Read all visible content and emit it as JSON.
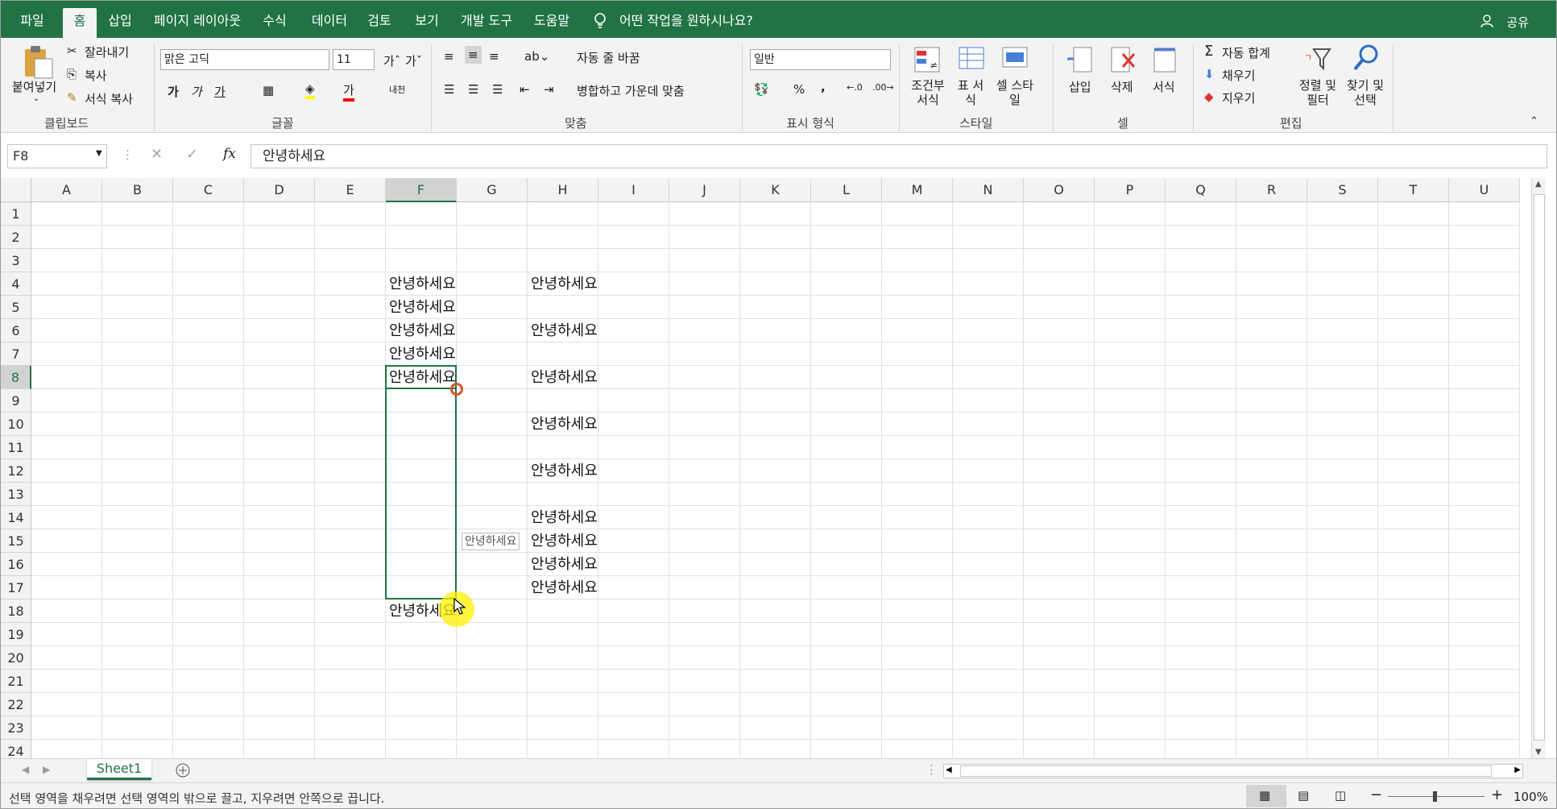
{
  "tabs": [
    "파일",
    "홈",
    "삽입",
    "페이지 레이아웃",
    "수식",
    "데이터",
    "검토",
    "보기",
    "개발 도구",
    "도움말"
  ],
  "tell_me": "어떤 작업을 원하시나요?",
  "share": "공유",
  "clipboard": {
    "paste": "붙여넣기",
    "cut": "잘라내기",
    "copy": "복사",
    "format_painter": "서식 복사",
    "group": "클립보드"
  },
  "font": {
    "name": "맑은 고딕",
    "size": "11",
    "bold": "가",
    "italic": "가",
    "underline": "가",
    "group": "글꼴",
    "color_glyph": "가",
    "phonetic": "내천"
  },
  "alignment": {
    "wrap": "자동 줄 바꿈",
    "merge": "병합하고 가운데 맞춤",
    "group": "맞춤"
  },
  "number": {
    "format": "일반",
    "percent": "%",
    "comma": ",",
    "group": "표시 형식"
  },
  "styles": {
    "conditional": "조건부 서식",
    "table": "표 서식",
    "cell": "셀 스타일",
    "group": "스타일"
  },
  "cells": {
    "insert": "삽입",
    "delete": "삭제",
    "format": "서식",
    "group": "셀"
  },
  "editing": {
    "autosum": "자동 합계",
    "fill": "채우기",
    "clear": "지우기",
    "sort": "정렬 및 필터",
    "find": "찾기 및 선택",
    "group": "편집"
  },
  "formula_bar": {
    "name_box": "F8",
    "fx": "fx",
    "value": "안녕하세요"
  },
  "columns": [
    "A",
    "B",
    "C",
    "D",
    "E",
    "F",
    "G",
    "H",
    "I",
    "J",
    "K",
    "L",
    "M",
    "N",
    "O",
    "P",
    "Q",
    "R",
    "S",
    "T",
    "U"
  ],
  "rows": [
    "1",
    "2",
    "3",
    "4",
    "5",
    "6",
    "7",
    "8",
    "9",
    "10",
    "11",
    "12",
    "13",
    "14",
    "15",
    "16",
    "17",
    "18",
    "19",
    "20",
    "21",
    "22",
    "23",
    "24"
  ],
  "cells_data": [
    {
      "col": "F",
      "row": "4",
      "v": "안녕하세요"
    },
    {
      "col": "H",
      "row": "4",
      "v": "안녕하세요"
    },
    {
      "col": "F",
      "row": "5",
      "v": "안녕하세요"
    },
    {
      "col": "F",
      "row": "6",
      "v": "안녕하세요"
    },
    {
      "col": "H",
      "row": "6",
      "v": "안녕하세요"
    },
    {
      "col": "F",
      "row": "7",
      "v": "안녕하세요"
    },
    {
      "col": "F",
      "row": "8",
      "v": "안녕하세요"
    },
    {
      "col": "H",
      "row": "8",
      "v": "안녕하세요"
    },
    {
      "col": "H",
      "row": "10",
      "v": "안녕하세요"
    },
    {
      "col": "H",
      "row": "12",
      "v": "안녕하세요"
    },
    {
      "col": "H",
      "row": "14",
      "v": "안녕하세요"
    },
    {
      "col": "H",
      "row": "15",
      "v": "안녕하세요"
    },
    {
      "col": "H",
      "row": "16",
      "v": "안녕하세요"
    },
    {
      "col": "H",
      "row": "17",
      "v": "안녕하세요"
    },
    {
      "col": "F",
      "row": "18",
      "v": "안녕하세요"
    }
  ],
  "fill_tooltip": "안녕하세요",
  "sheet_tab": "Sheet1",
  "status_text": "선택 영역을 채우려면 선택 영역의 밖으로 끌고, 지우려면 안쪽으로 끕니다.",
  "zoom": "100%",
  "colors": {
    "accent": "#217346",
    "ribbon_bg": "#f3f3f3",
    "highlight": "#ffff00"
  },
  "icons": [
    "lightbulb-icon",
    "person-icon",
    "paste-icon",
    "scissors-icon",
    "copy-icon",
    "brush-icon",
    "fx-icon",
    "plus-icon",
    "zoom-slider-icon"
  ]
}
